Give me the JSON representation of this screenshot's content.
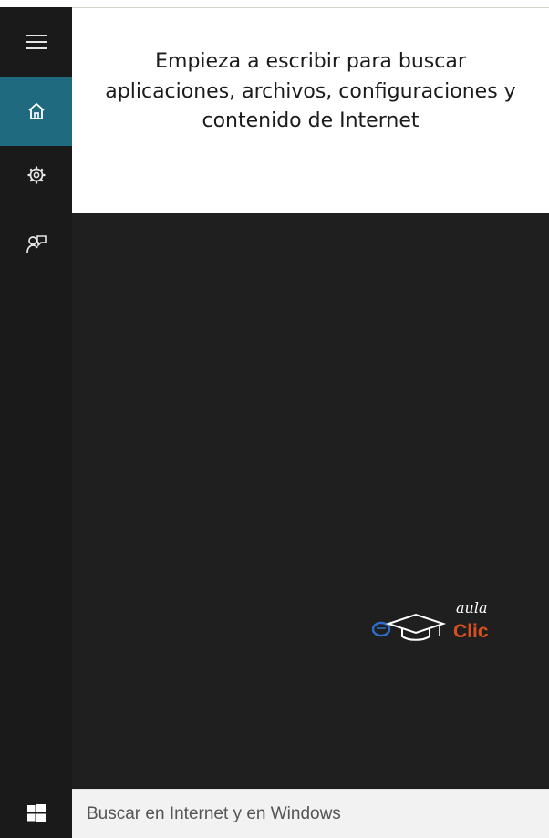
{
  "rail": {
    "items": [
      {
        "icon": "hamburger-menu-icon"
      },
      {
        "icon": "home-icon",
        "active": true
      },
      {
        "icon": "gear-icon"
      },
      {
        "icon": "feedback-icon"
      }
    ]
  },
  "hint": {
    "text": "Empieza a escribir para buscar aplicaciones, archivos, configuraciones y contenido de Internet"
  },
  "logo": {
    "top_text": "aula",
    "bottom_text": "Clic",
    "colors": {
      "bottom": "#d8501f",
      "icon_blue": "#2e6ec8"
    }
  },
  "taskbar": {
    "start_icon": "windows-logo-icon",
    "search_placeholder": "Buscar en Internet y en Windows"
  },
  "colors": {
    "accent": "#1f6a7e",
    "rail": "#1a1a1a",
    "panel_dark": "#1f1f1f"
  }
}
